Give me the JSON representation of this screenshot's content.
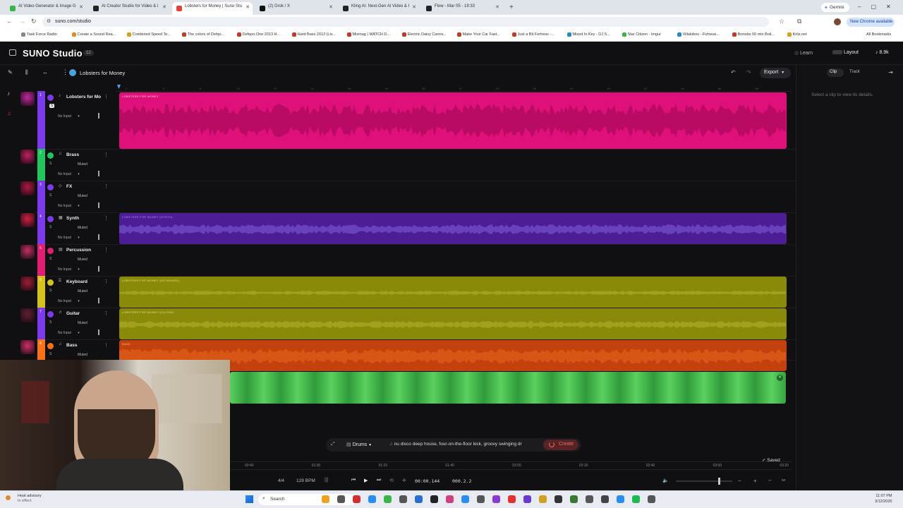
{
  "browser": {
    "tabs": [
      {
        "title": "AI Video Generator & Image G",
        "color": "#3bb54a"
      },
      {
        "title": "AI Creator Studio for Video & I",
        "color": "#222"
      },
      {
        "title": "Lobsters for Money | Suno Stu",
        "color": "#e0433a"
      },
      {
        "title": "(2) Grok / X",
        "color": "#111"
      },
      {
        "title": "Kling AI: Next-Gen AI Video & I",
        "color": "#222"
      },
      {
        "title": "Flow - Mar 05 - 19:33",
        "color": "#222"
      }
    ],
    "gemini": "Gemini",
    "url": "suno.com/studio",
    "chrome_update": "New Chrome available",
    "bookmarks": [
      "Task Force Radio",
      "Create a Sound Rea...",
      "Combined Speed Te...",
      "The colors of Defqo...",
      "Defqon.One 2013 H...",
      "Hard Bass 2013 (Liv...",
      "Mixmag | WATCH D...",
      "Electric Daisy Carniv...",
      "Make Your Car Fast...",
      "Just a Bit Fortress -...",
      "Mixed In Key - DJ S...",
      "Star Citizen - Imgur",
      "Villalobos - Fizheue...",
      "Bonobo 50 min Boil...",
      "Kritz.net"
    ],
    "all_bookmarks": "All Bookmarks"
  },
  "app": {
    "logo": "SUNO Studio",
    "version": "12",
    "learn": "Learn",
    "layout": "Layout",
    "credits": "8.9k",
    "project": "Lobsters for Money",
    "export": "Export",
    "panel_tabs": [
      "Clip",
      "Track"
    ],
    "panel_hint": "Select a clip to view its details."
  },
  "ruler": [
    "1",
    "5",
    "9",
    "13",
    "17",
    "21",
    "25",
    "29",
    "33",
    "37",
    "41",
    "45",
    "49",
    "53",
    "57",
    "61",
    "65",
    "69"
  ],
  "tracks": [
    {
      "num": "1",
      "name": "Lobsters for Mo",
      "input": "No Input",
      "muted": "",
      "color": "#7c3aed"
    },
    {
      "num": "2",
      "name": "Brass",
      "input": "No Input",
      "muted": "Muted",
      "color": "#22c55e"
    },
    {
      "num": "3",
      "name": "FX",
      "input": "No Input",
      "muted": "Muted",
      "color": "#7c3aed"
    },
    {
      "num": "4",
      "name": "Synth",
      "input": "No Input",
      "muted": "Muted",
      "color": "#7c3aed"
    },
    {
      "num": "5",
      "name": "Percussion",
      "input": "No Input",
      "muted": "Muted",
      "color": "#e11d74"
    },
    {
      "num": "6",
      "name": "Keyboard",
      "input": "No Input",
      "muted": "Muted",
      "color": "#d4c21a"
    },
    {
      "num": "7",
      "name": "Guitar",
      "input": "No Input",
      "muted": "Muted",
      "color": "#7c3aed"
    },
    {
      "num": "8",
      "name": "Bass",
      "input": "",
      "muted": "Muted",
      "color": "#f97316"
    }
  ],
  "clips": [
    {
      "label": "LOBSTERS FOR MONEY",
      "color": "#e0107a"
    },
    {
      "label": "LOBSTERS FOR MONEY (SYNTH)",
      "color": "#4c1d95"
    },
    {
      "label": "LOBSTERS FOR MONEY (KEYBOARD)",
      "color": "#8a8a0a"
    },
    {
      "label": "LOBSTERS FOR MONEY (GUITAR)",
      "color": "#8a8a0a"
    },
    {
      "label": "BASS",
      "color": "#c2410c"
    },
    {
      "label": "",
      "color": "#3fbf4a"
    }
  ],
  "prompt": {
    "instrument": "Drums",
    "text": "nu disco deep house, four-on-the-floor kick, groovy swinging dr",
    "create": "Create",
    "saved": "Saved"
  },
  "timeline_ticks": [
    "00:40",
    "01:00",
    "01:20",
    "01:40",
    "02:00",
    "02:20",
    "02:40",
    "03:00",
    "03:20"
  ],
  "transport": {
    "time_sig": "4/4",
    "bpm": "128 BPM",
    "time": "00:00.144",
    "bar": "000.2.2"
  },
  "taskbar": {
    "weather": "Heat advisory",
    "weather_sub": "In effect",
    "search": "Search",
    "clock": "11:07 PM",
    "date": "3/12/2026"
  }
}
